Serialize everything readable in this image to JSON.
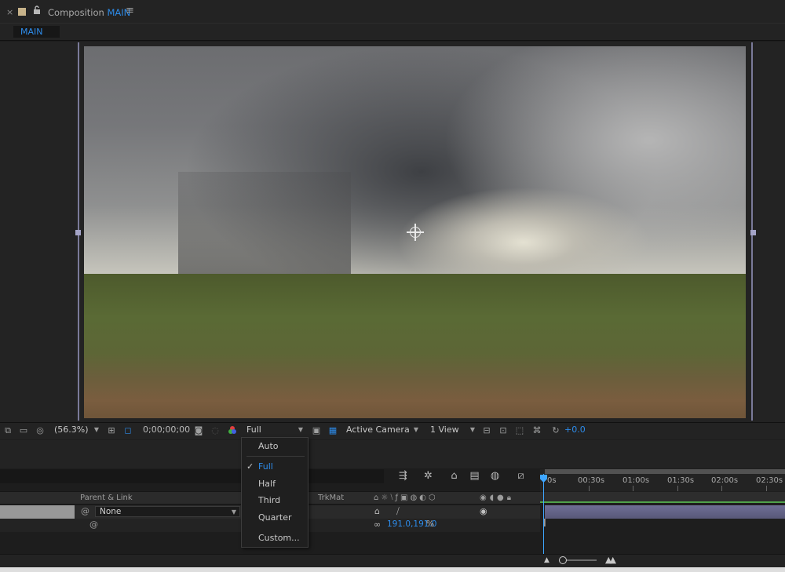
{
  "panel": {
    "close": "×",
    "title_prefix": "Composition",
    "title_name": "MAIN",
    "menu": "≡"
  },
  "breadcrumb": {
    "label": "MAIN"
  },
  "viewer_bar": {
    "zoom": "(56.3%)",
    "timecode": "0;00;00;00",
    "resolution": "Full",
    "camera": "Active Camera",
    "views": "1 View",
    "exposure": "+0.0"
  },
  "resolution_menu": {
    "items": [
      {
        "label": "Auto",
        "checked": false
      },
      {
        "label": "Full",
        "checked": true
      },
      {
        "label": "Half",
        "checked": false
      },
      {
        "label": "Third",
        "checked": false
      },
      {
        "label": "Quarter",
        "checked": false
      },
      {
        "label": "Custom...",
        "checked": false
      }
    ],
    "check_glyph": "✓"
  },
  "timeline": {
    "headers": {
      "parent": "Parent & Link",
      "trkmat": "TrkMat"
    },
    "layer": {
      "parent_value": "None"
    },
    "scale": {
      "value": "191.0,191.0",
      "unit": "%"
    },
    "ruler": [
      "0s",
      "00:30s",
      "01:00s",
      "01:30s",
      "02:00s",
      "02:30s"
    ]
  },
  "colors": {
    "accent": "#2d8ceb",
    "layer_bar": "#6e6e95",
    "work_area": "#4fa24a",
    "playhead": "#3ea6ff"
  },
  "icons": {
    "close": "close-icon",
    "lock": "lock-icon",
    "camera": "snapshot-icon",
    "color": "channel-icon",
    "reset_exposure": "reset-exposure-icon"
  }
}
